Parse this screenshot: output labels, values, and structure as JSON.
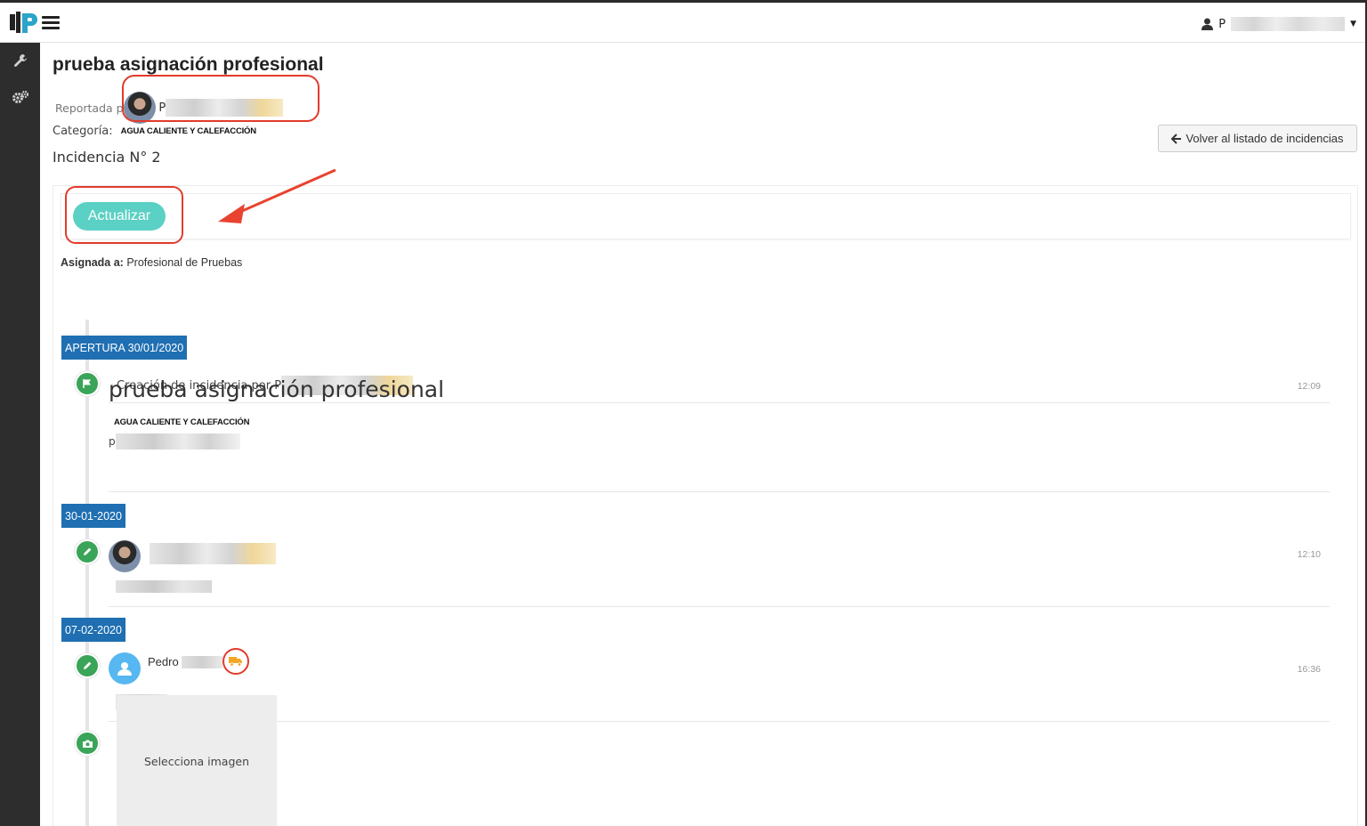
{
  "header": {
    "user_initial": "P"
  },
  "page": {
    "title": "prueba asignación profesional",
    "reported_by_label": "Reportada por",
    "reporter_initial": "P",
    "category_label": "Categoría:",
    "category_value": "AGUA CALIENTE Y CALEFACCIÓN",
    "incident_label": "Incidencia N° 2",
    "back_button": "Volver al listado de incidencias"
  },
  "actions": {
    "update_button": "Actualizar"
  },
  "assignment": {
    "label": "Asignada a:",
    "value": "Profesional de Pruebas"
  },
  "timeline": {
    "apertura_badge": "APERTURA 30/01/2020",
    "creation_text": "Creación de incidencia por P",
    "creation_time": "12:09",
    "issue_title": "prueba asignación profesional",
    "issue_category": "AGUA CALIENTE Y CALEFACCIÓN",
    "issue_desc_initial": "p",
    "date2_badge": "30-01-2020",
    "entry2_time": "12:10",
    "date3_badge": "07-02-2020",
    "entry3_name": "Pedro",
    "entry3_time": "16:36",
    "image_placeholder": "Selecciona imagen"
  },
  "colors": {
    "accent_teal": "#5bd0c4",
    "badge_blue": "#1f6fb2",
    "timeline_green": "#3aa458",
    "annotation_red": "#e23b2b",
    "truck_orange": "#f5a623"
  }
}
